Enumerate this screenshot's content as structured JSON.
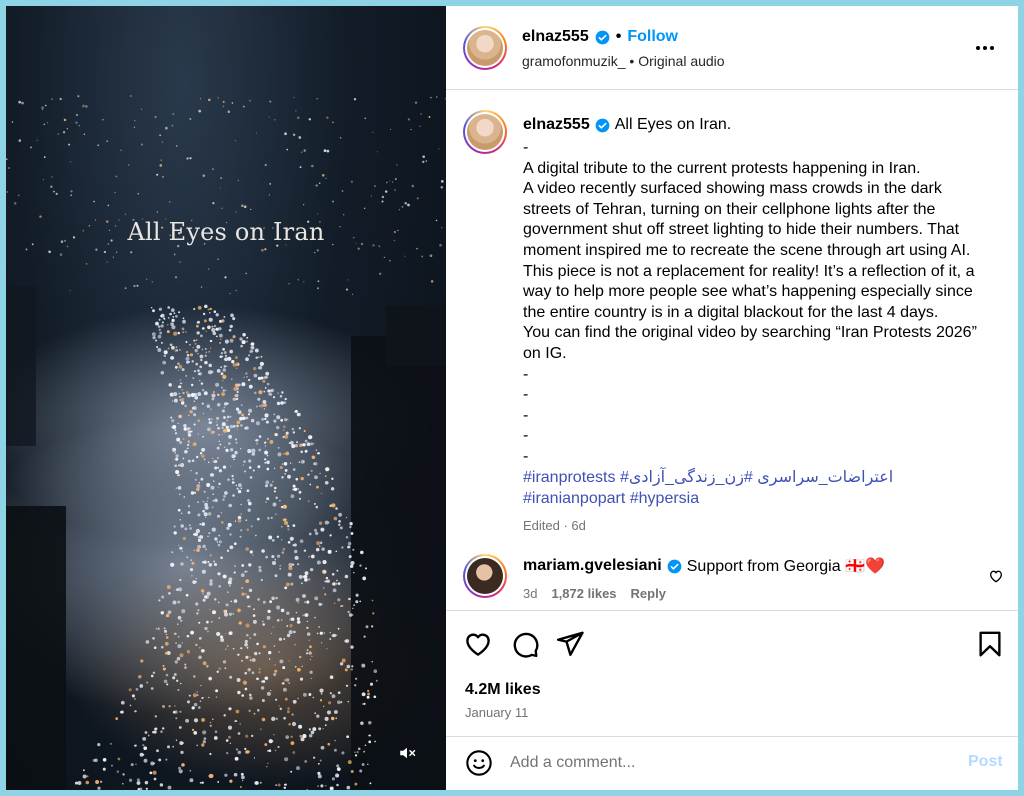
{
  "media": {
    "overlay_text": "All Eyes on Iran",
    "mute_icon": "speaker-muted-icon"
  },
  "header": {
    "username": "elnaz555",
    "separator": "•",
    "follow_label": "Follow",
    "audio_user": "gramofonmuzik_",
    "audio_separator": "•",
    "audio_label": "Original audio"
  },
  "caption": {
    "username": "elnaz555",
    "title": "All Eyes on Iran.",
    "body": "-\nA digital tribute to the current protests happening in Iran.\nA video recently surfaced showing mass crowds in the dark streets of Tehran, turning on their cellphone lights after the government shut off street lighting to hide their numbers. That moment inspired me to recreate the scene through art using AI. This piece is not a replacement for reality! It’s a reflection of it, a way to help more people see what’s happening especially since the entire country is in a digital blackout for the last 4 days.\nYou can find the original video by searching “Iran Protests 2026” on IG.\n-\n-\n-\n-\n-",
    "hashtags": [
      "#iranprotests",
      "#اعتراضات_سراسری",
      "#زن_زندگی_آزادی",
      "#iranianpopart",
      "#hypersia"
    ],
    "edited": "Edited · 6d"
  },
  "comment": {
    "username": "mariam.gvelesiani",
    "text": "Support from Georgia 🇬🇪❤️",
    "age": "3d",
    "likes": "1,872 likes",
    "reply_label": "Reply"
  },
  "actions": {
    "likes": "4.2M likes",
    "date": "January 11"
  },
  "add_comment": {
    "placeholder": "Add a comment...",
    "post_label": "Post"
  },
  "colors": {
    "link": "#0095f6",
    "hashtag": "#3f51b5",
    "muted_text": "#737373",
    "divider": "#dbdbdb",
    "post_disabled": "#b3dbff"
  }
}
